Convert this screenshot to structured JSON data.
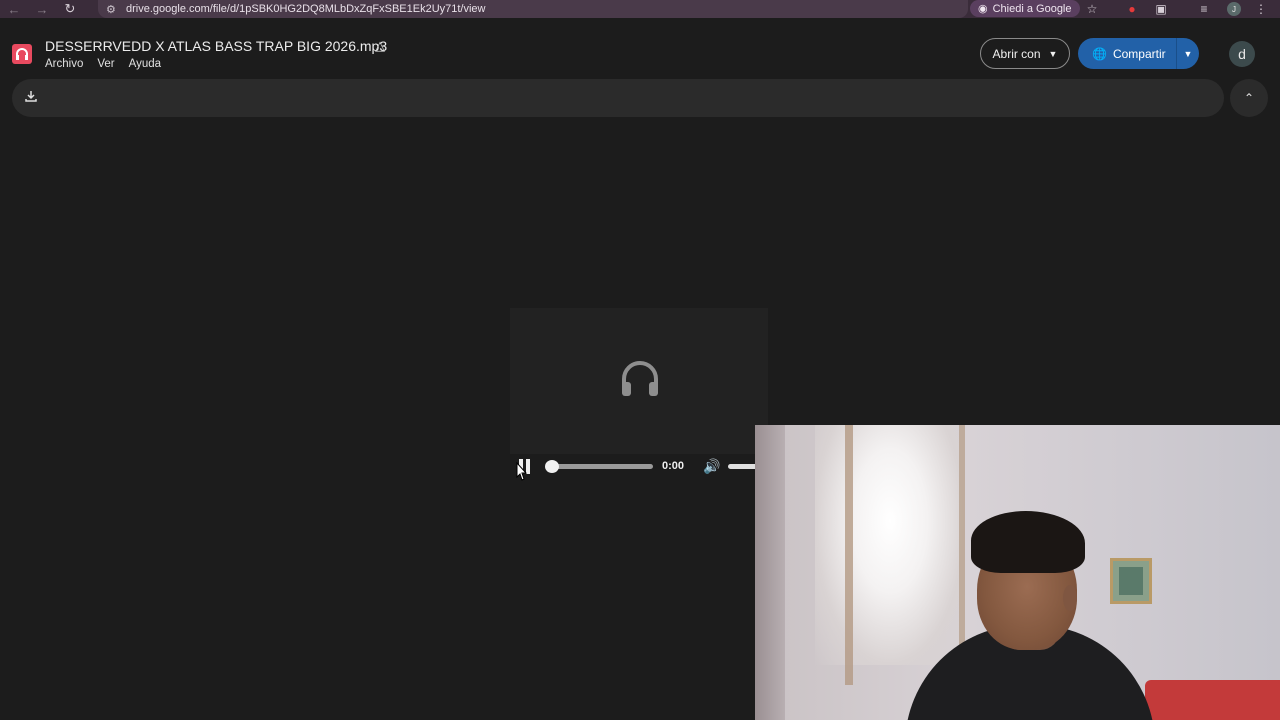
{
  "browser": {
    "url": "drive.google.com/file/d/1pSBK0HG2DQ8MLbDxZqFxSBE1Ek2Uy71t/view",
    "ask_google_label": "Chiedi a Google",
    "profile_initial": "J",
    "accent_color": "#3a2c3a",
    "icons": [
      "back-arrow-icon",
      "forward-arrow-icon",
      "reload-icon",
      "site-settings-icon",
      "star-icon",
      "extension-red-icon",
      "extensions-puzzle-icon",
      "media-queue-icon",
      "kebab-menu-icon"
    ]
  },
  "drive": {
    "file_title": "DESSERRVEDD X ATLAS BASS TRAP BIG 2026.mp3",
    "menu": [
      "Archivo",
      "Ver",
      "Ayuda"
    ],
    "open_with_label": "Abrir con",
    "share_label": "Compartir",
    "avatar_initial": "d",
    "share_color": "#2261a8",
    "app_icon_color": "#e84a5f"
  },
  "player": {
    "time": "0:00",
    "progress": 0.0,
    "volume": 1.0,
    "state": "playing"
  }
}
